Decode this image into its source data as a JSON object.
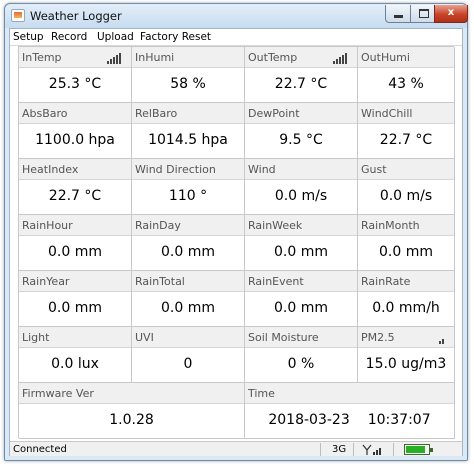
{
  "window": {
    "title": "Weather Logger",
    "min_glyph": "",
    "max_glyph": "",
    "close_glyph": "x"
  },
  "menu": [
    "Setup",
    "Record",
    "Upload",
    "Factory Reset"
  ],
  "readings": [
    {
      "label": "InTemp",
      "value": "25.3 °C",
      "signal": true
    },
    {
      "label": "InHumi",
      "value": "58 %"
    },
    {
      "label": "OutTemp",
      "value": "22.7 °C",
      "signal": true
    },
    {
      "label": "OutHumi",
      "value": "43 %"
    },
    {
      "label": "AbsBaro",
      "value": "1100.0 hpa"
    },
    {
      "label": "RelBaro",
      "value": "1014.5 hpa"
    },
    {
      "label": "DewPoint",
      "value": "9.5 °C"
    },
    {
      "label": "WindChill",
      "value": "22.7 °C"
    },
    {
      "label": "HeatIndex",
      "value": "22.7 °C"
    },
    {
      "label": "Wind Direction",
      "value": "110 °"
    },
    {
      "label": "Wind",
      "value": "0.0 m/s"
    },
    {
      "label": "Gust",
      "value": "0.0 m/s"
    },
    {
      "label": "RainHour",
      "value": "0.0 mm"
    },
    {
      "label": "RainDay",
      "value": "0.0 mm"
    },
    {
      "label": "RainWeek",
      "value": "0.0 mm"
    },
    {
      "label": "RainMonth",
      "value": "0.0 mm"
    },
    {
      "label": "RainYear",
      "value": "0.0 mm"
    },
    {
      "label": "RainTotal",
      "value": "0.0 mm"
    },
    {
      "label": "RainEvent",
      "value": "0.0 mm"
    },
    {
      "label": "RainRate",
      "value": "0.0 mm/h"
    },
    {
      "label": "Light",
      "value": "0.0 lux"
    },
    {
      "label": "UVI",
      "value": "0"
    },
    {
      "label": "Soil Moisture",
      "value": "0 %"
    },
    {
      "label": "PM2.5",
      "value": "15.0 ug/m3",
      "signal": true
    }
  ],
  "firmware": {
    "label": "Firmware Ver",
    "value": "1.0.28"
  },
  "time": {
    "label": "Time",
    "date": "2018-03-23",
    "clock": "10:37:07"
  },
  "status": {
    "connection": "Connected",
    "network": "3G",
    "signal_icon": "antenna-signal-icon",
    "battery_icon": "battery-icon",
    "battery_level": 0.8,
    "battery_color": "#27b024"
  }
}
